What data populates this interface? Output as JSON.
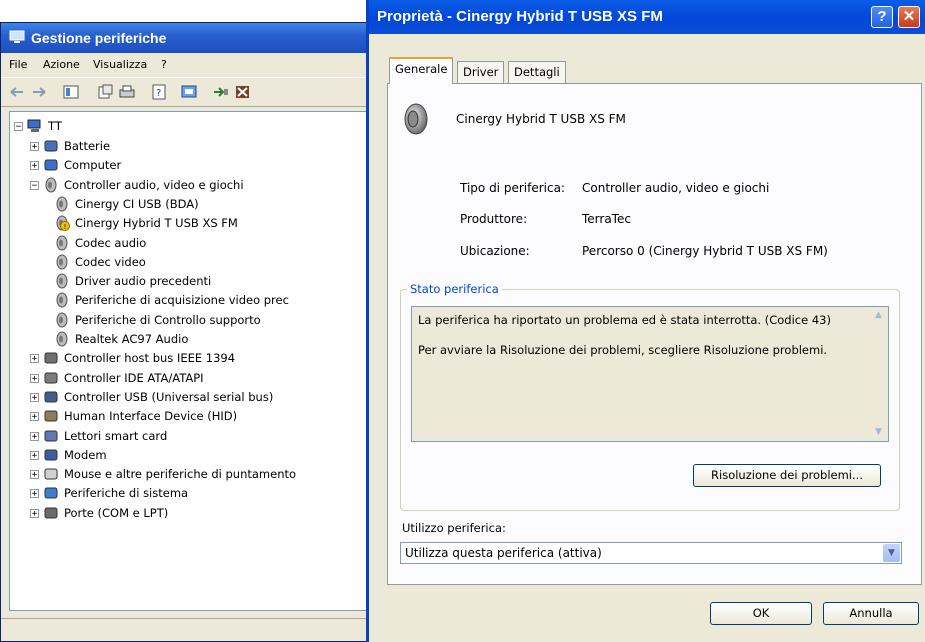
{
  "device_manager": {
    "title": "Gestione periferiche",
    "menu": [
      "File",
      "Azione",
      "Visualizza",
      "?"
    ],
    "tree": {
      "root": "TT",
      "nodes": [
        {
          "label": "Batterie",
          "icon": "battery-icon"
        },
        {
          "label": "Computer",
          "icon": "computer-icon"
        },
        {
          "label": "Controller audio, video e giochi",
          "icon": "speaker-icon"
        },
        {
          "label": "Cinergy CI USB (BDA)",
          "icon": "speaker-icon"
        },
        {
          "label": "Cinergy Hybrid T USB XS FM",
          "icon": "speaker-warning-icon"
        },
        {
          "label": "Codec audio",
          "icon": "speaker-icon"
        },
        {
          "label": "Codec video",
          "icon": "speaker-icon"
        },
        {
          "label": "Driver audio precedenti",
          "icon": "speaker-icon"
        },
        {
          "label": "Periferiche di acquisizione video prec",
          "icon": "speaker-icon"
        },
        {
          "label": "Periferiche di Controllo supporto",
          "icon": "speaker-icon"
        },
        {
          "label": "Realtek AC97 Audio",
          "icon": "speaker-icon"
        },
        {
          "label": "Controller host bus IEEE 1394",
          "icon": "bus-icon"
        },
        {
          "label": "Controller IDE ATA/ATAPI",
          "icon": "disk-controller-icon"
        },
        {
          "label": "Controller USB (Universal serial bus)",
          "icon": "usb-icon"
        },
        {
          "label": "Human Interface Device (HID)",
          "icon": "hid-icon"
        },
        {
          "label": "Lettori smart card",
          "icon": "smartcard-icon"
        },
        {
          "label": "Modem",
          "icon": "modem-icon"
        },
        {
          "label": "Mouse e altre periferiche di puntamento",
          "icon": "mouse-icon"
        },
        {
          "label": "Periferiche di sistema",
          "icon": "system-device-icon"
        },
        {
          "label": "Porte (COM e LPT)",
          "icon": "port-icon"
        }
      ]
    }
  },
  "dialog": {
    "title": "Proprietà - Cinergy Hybrid T USB XS FM",
    "help_glyph": "?",
    "close_glyph": "✕",
    "tabs": [
      "Generale",
      "Driver",
      "Dettagli"
    ],
    "device_name": "Cinergy Hybrid T USB XS FM",
    "props": [
      {
        "label": "Tipo di periferica:",
        "value": "Controller audio, video e giochi"
      },
      {
        "label": "Produttore:",
        "value": "TerraTec"
      },
      {
        "label": "Ubicazione:",
        "value": "Percorso 0 (Cinergy Hybrid T USB XS FM)"
      }
    ],
    "status_group": "Stato periferica",
    "status_line1": "La periferica ha riportato un problema ed è stata interrotta. (Codice 43)",
    "status_line2": "Per avviare la Risoluzione dei problemi, scegliere Risoluzione problemi.",
    "troubleshoot_button": "Risoluzione dei problemi...",
    "usage_label": "Utilizzo periferica:",
    "usage_value": "Utilizza questa periferica (attiva)",
    "ok_button": "OK",
    "cancel_button": "Annulla"
  }
}
